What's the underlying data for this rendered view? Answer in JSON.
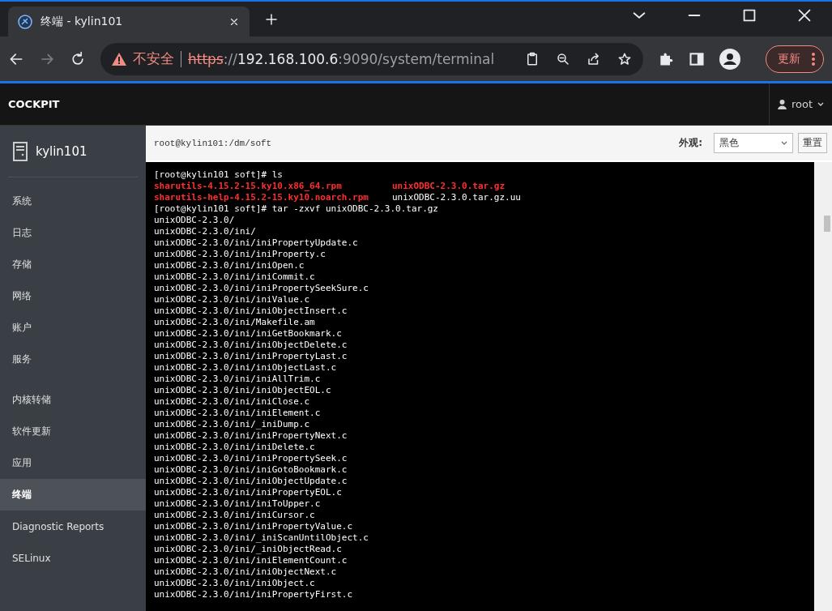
{
  "browser": {
    "tab": {
      "title": "终端 - kylin101"
    },
    "security": "不安全",
    "url": {
      "scheme": "https",
      "rest_scheme": "://",
      "host": "192.168.100.6",
      "path": ":9090/system/terminal"
    },
    "update_button": "更新"
  },
  "header": {
    "brand": "COCKPIT",
    "user": "root"
  },
  "sidebar": {
    "host": "kylin101",
    "groups": [
      [
        {
          "label": "系统",
          "selected": false
        },
        {
          "label": "日志",
          "selected": false
        },
        {
          "label": "存储",
          "selected": false
        },
        {
          "label": "网络",
          "selected": false
        },
        {
          "label": "账户",
          "selected": false
        },
        {
          "label": "服务",
          "selected": false
        }
      ],
      [
        {
          "label": "内核转储",
          "selected": false
        },
        {
          "label": "软件更新",
          "selected": false
        },
        {
          "label": "应用",
          "selected": false
        },
        {
          "label": "终端",
          "selected": true
        },
        {
          "label": "Diagnostic Reports",
          "selected": false
        },
        {
          "label": "SELinux",
          "selected": false
        }
      ]
    ]
  },
  "terminal": {
    "title": "root@kylin101:/dm/soft",
    "appearance_label": "外观:",
    "appearance": "黑色",
    "reset_button": "重置",
    "lines": [
      [
        {
          "text": "[root@kylin101 soft]# ls",
          "kind": "plain"
        }
      ],
      [
        {
          "text": "sharutils-4.15.2-15.ky10.x86_64.rpm",
          "kind": "package"
        },
        {
          "text": "unixODBC-2.3.0.tar.gz",
          "kind": "package"
        }
      ],
      [
        {
          "text": "sharutils-help-4.15.2-15.ky10.noarch.rpm",
          "kind": "package"
        },
        {
          "text": "unixODBC-2.3.0.tar.gz.uu",
          "kind": "plain"
        }
      ],
      [
        {
          "text": "[root@kylin101 soft]# tar -zxvf unixODBC-2.3.0.tar.gz",
          "kind": "plain"
        }
      ],
      [
        {
          "text": "unixODBC-2.3.0/",
          "kind": "plain"
        }
      ],
      [
        {
          "text": "unixODBC-2.3.0/ini/",
          "kind": "plain"
        }
      ],
      [
        {
          "text": "unixODBC-2.3.0/ini/iniPropertyUpdate.c",
          "kind": "plain"
        }
      ],
      [
        {
          "text": "unixODBC-2.3.0/ini/iniProperty.c",
          "kind": "plain"
        }
      ],
      [
        {
          "text": "unixODBC-2.3.0/ini/iniOpen.c",
          "kind": "plain"
        }
      ],
      [
        {
          "text": "unixODBC-2.3.0/ini/iniCommit.c",
          "kind": "plain"
        }
      ],
      [
        {
          "text": "unixODBC-2.3.0/ini/iniPropertySeekSure.c",
          "kind": "plain"
        }
      ],
      [
        {
          "text": "unixODBC-2.3.0/ini/iniValue.c",
          "kind": "plain"
        }
      ],
      [
        {
          "text": "unixODBC-2.3.0/ini/iniObjectInsert.c",
          "kind": "plain"
        }
      ],
      [
        {
          "text": "unixODBC-2.3.0/ini/Makefile.am",
          "kind": "plain"
        }
      ],
      [
        {
          "text": "unixODBC-2.3.0/ini/iniGetBookmark.c",
          "kind": "plain"
        }
      ],
      [
        {
          "text": "unixODBC-2.3.0/ini/iniObjectDelete.c",
          "kind": "plain"
        }
      ],
      [
        {
          "text": "unixODBC-2.3.0/ini/iniPropertyLast.c",
          "kind": "plain"
        }
      ],
      [
        {
          "text": "unixODBC-2.3.0/ini/iniObjectLast.c",
          "kind": "plain"
        }
      ],
      [
        {
          "text": "unixODBC-2.3.0/ini/iniAllTrim.c",
          "kind": "plain"
        }
      ],
      [
        {
          "text": "unixODBC-2.3.0/ini/iniObjectEOL.c",
          "kind": "plain"
        }
      ],
      [
        {
          "text": "unixODBC-2.3.0/ini/iniClose.c",
          "kind": "plain"
        }
      ],
      [
        {
          "text": "unixODBC-2.3.0/ini/iniElement.c",
          "kind": "plain"
        }
      ],
      [
        {
          "text": "unixODBC-2.3.0/ini/_iniDump.c",
          "kind": "plain"
        }
      ],
      [
        {
          "text": "unixODBC-2.3.0/ini/iniPropertyNext.c",
          "kind": "plain"
        }
      ],
      [
        {
          "text": "unixODBC-2.3.0/ini/iniDelete.c",
          "kind": "plain"
        }
      ],
      [
        {
          "text": "unixODBC-2.3.0/ini/iniPropertySeek.c",
          "kind": "plain"
        }
      ],
      [
        {
          "text": "unixODBC-2.3.0/ini/iniGotoBookmark.c",
          "kind": "plain"
        }
      ],
      [
        {
          "text": "unixODBC-2.3.0/ini/iniObjectUpdate.c",
          "kind": "plain"
        }
      ],
      [
        {
          "text": "unixODBC-2.3.0/ini/iniPropertyEOL.c",
          "kind": "plain"
        }
      ],
      [
        {
          "text": "unixODBC-2.3.0/ini/iniToUpper.c",
          "kind": "plain"
        }
      ],
      [
        {
          "text": "unixODBC-2.3.0/ini/iniCursor.c",
          "kind": "plain"
        }
      ],
      [
        {
          "text": "unixODBC-2.3.0/ini/iniPropertyValue.c",
          "kind": "plain"
        }
      ],
      [
        {
          "text": "unixODBC-2.3.0/ini/_iniScanUntilObject.c",
          "kind": "plain"
        }
      ],
      [
        {
          "text": "unixODBC-2.3.0/ini/_iniObjectRead.c",
          "kind": "plain"
        }
      ],
      [
        {
          "text": "unixODBC-2.3.0/ini/iniElementCount.c",
          "kind": "plain"
        }
      ],
      [
        {
          "text": "unixODBC-2.3.0/ini/iniObjectNext.c",
          "kind": "plain"
        }
      ],
      [
        {
          "text": "unixODBC-2.3.0/ini/iniObject.c",
          "kind": "plain"
        }
      ],
      [
        {
          "text": "unixODBC-2.3.0/ini/iniPropertyFirst.c",
          "kind": "plain"
        }
      ]
    ]
  }
}
